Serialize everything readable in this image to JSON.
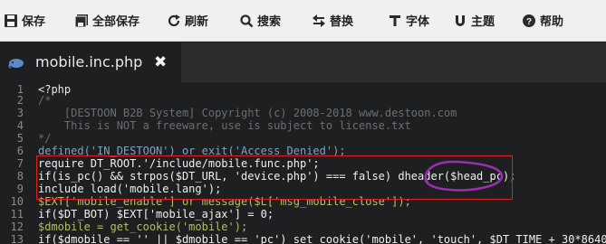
{
  "toolbar": {
    "buttons": [
      {
        "label": "保存",
        "icon": "save-icon"
      },
      {
        "label": "全部保存",
        "icon": "save-all-icon"
      },
      {
        "label": "刷新",
        "icon": "refresh-icon"
      },
      {
        "label": "搜索",
        "icon": "search-icon"
      },
      {
        "label": "替换",
        "icon": "replace-icon"
      },
      {
        "label": "字体",
        "icon": "font-icon"
      },
      {
        "label": "主题",
        "icon": "theme-icon"
      },
      {
        "label": "帮助",
        "icon": "help-icon"
      }
    ]
  },
  "tab": {
    "title": "mobile.inc.php",
    "close": "✖",
    "icon": "php-elephant-icon"
  },
  "editor": {
    "line_numbers": [
      "1",
      "2",
      "3",
      "4",
      "5",
      "6",
      "7",
      "8",
      "9",
      "10",
      "11",
      "12",
      "13"
    ],
    "lines": [
      "<?php",
      "/*",
      "    [DESTOON B2B System] Copyright (c) 2008-2018 www.destoon.com",
      "    This is NOT a freeware, use is subject to license.txt",
      "*/",
      "defined('IN_DESTOON') or exit('Access Denied');",
      "require DT_ROOT.'/include/mobile.func.php';",
      "if(is_pc() && strpos($DT_URL, 'device.php') === false) dheader($head_pc);",
      "include load('mobile.lang');",
      "$EXT['mobile_enable'] or message($L['msg_mobile_close']);",
      "if($DT_BOT) $EXT['mobile_ajax'] = 0;",
      "$dmobile = get_cookie('mobile');",
      "if($dmobile == '' || $dmobile == 'pc') set_cookie('mobile', 'touch', $DT_TIME + 30*86400);"
    ]
  },
  "colors": {
    "toolbar_bg": "#f0f0f0",
    "editor_bg": "#1d1f21",
    "highlight_box": "#e02020",
    "annotation_loop": "#9b2fae"
  }
}
